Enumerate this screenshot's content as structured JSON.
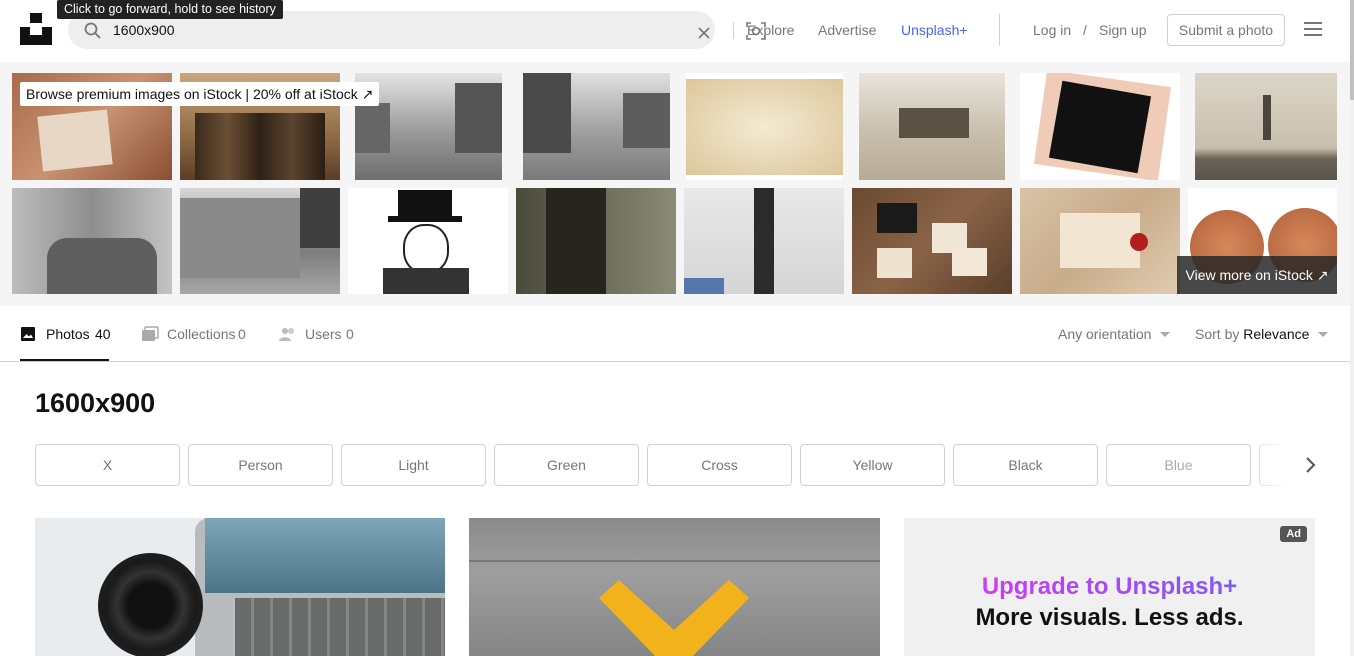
{
  "tooltip": "Click to go forward, hold to see history",
  "search": {
    "query": "1600x900"
  },
  "nav": {
    "explore": "Explore",
    "advertise": "Advertise",
    "unsplash_plus": "Unsplash+",
    "login": "Log in",
    "separator": "/",
    "signup": "Sign up",
    "submit": "Submit a photo"
  },
  "banner": {
    "istock_label": "Browse premium images on iStock | 20% off at iStock ↗",
    "view_more": "View more on iStock ↗"
  },
  "tabs": {
    "photos_label": "Photos",
    "photos_count": "40",
    "collections_label": "Collections",
    "collections_count": "0",
    "users_label": "Users",
    "users_count": "0"
  },
  "filters": {
    "orientation": "Any orientation",
    "sort_prefix": "Sort by",
    "sort_value": "Relevance"
  },
  "page_title": "1600x900",
  "chips": [
    "X",
    "Person",
    "Light",
    "Green",
    "Cross",
    "Yellow",
    "Black",
    "Blue"
  ],
  "ad": {
    "badge": "Ad",
    "line1": "Upgrade to Unsplash+",
    "line2": "More visuals. Less ads."
  },
  "colors": {
    "accent": "#4d63f2",
    "ad_gradient_start": "#d13af0",
    "ad_gradient_end": "#7d5cf0"
  }
}
